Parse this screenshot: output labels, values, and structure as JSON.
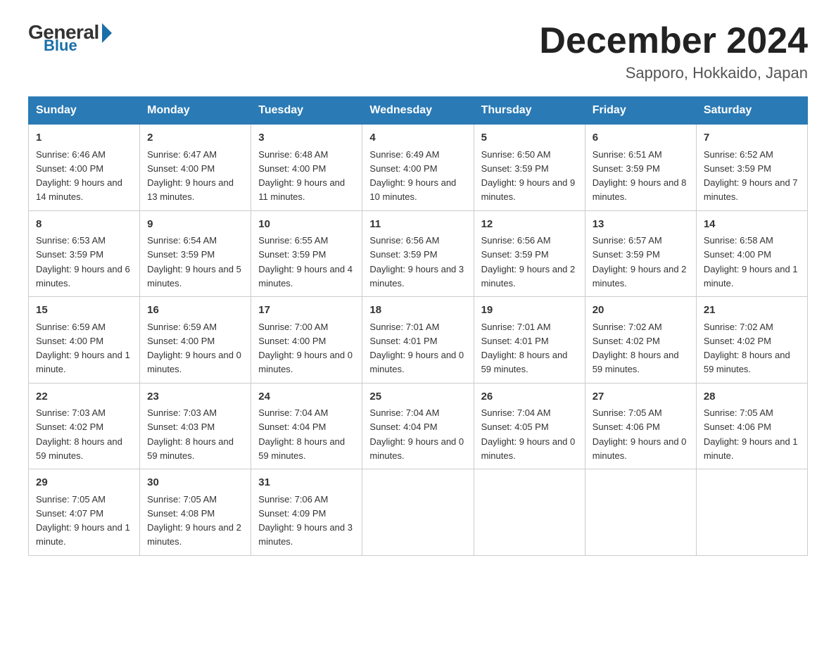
{
  "logo": {
    "general": "General",
    "blue": "Blue"
  },
  "title": "December 2024",
  "location": "Sapporo, Hokkaido, Japan",
  "headers": [
    "Sunday",
    "Monday",
    "Tuesday",
    "Wednesday",
    "Thursday",
    "Friday",
    "Saturday"
  ],
  "weeks": [
    [
      {
        "day": "1",
        "sunrise": "6:46 AM",
        "sunset": "4:00 PM",
        "daylight": "9 hours and 14 minutes."
      },
      {
        "day": "2",
        "sunrise": "6:47 AM",
        "sunset": "4:00 PM",
        "daylight": "9 hours and 13 minutes."
      },
      {
        "day": "3",
        "sunrise": "6:48 AM",
        "sunset": "4:00 PM",
        "daylight": "9 hours and 11 minutes."
      },
      {
        "day": "4",
        "sunrise": "6:49 AM",
        "sunset": "4:00 PM",
        "daylight": "9 hours and 10 minutes."
      },
      {
        "day": "5",
        "sunrise": "6:50 AM",
        "sunset": "3:59 PM",
        "daylight": "9 hours and 9 minutes."
      },
      {
        "day": "6",
        "sunrise": "6:51 AM",
        "sunset": "3:59 PM",
        "daylight": "9 hours and 8 minutes."
      },
      {
        "day": "7",
        "sunrise": "6:52 AM",
        "sunset": "3:59 PM",
        "daylight": "9 hours and 7 minutes."
      }
    ],
    [
      {
        "day": "8",
        "sunrise": "6:53 AM",
        "sunset": "3:59 PM",
        "daylight": "9 hours and 6 minutes."
      },
      {
        "day": "9",
        "sunrise": "6:54 AM",
        "sunset": "3:59 PM",
        "daylight": "9 hours and 5 minutes."
      },
      {
        "day": "10",
        "sunrise": "6:55 AM",
        "sunset": "3:59 PM",
        "daylight": "9 hours and 4 minutes."
      },
      {
        "day": "11",
        "sunrise": "6:56 AM",
        "sunset": "3:59 PM",
        "daylight": "9 hours and 3 minutes."
      },
      {
        "day": "12",
        "sunrise": "6:56 AM",
        "sunset": "3:59 PM",
        "daylight": "9 hours and 2 minutes."
      },
      {
        "day": "13",
        "sunrise": "6:57 AM",
        "sunset": "3:59 PM",
        "daylight": "9 hours and 2 minutes."
      },
      {
        "day": "14",
        "sunrise": "6:58 AM",
        "sunset": "4:00 PM",
        "daylight": "9 hours and 1 minute."
      }
    ],
    [
      {
        "day": "15",
        "sunrise": "6:59 AM",
        "sunset": "4:00 PM",
        "daylight": "9 hours and 1 minute."
      },
      {
        "day": "16",
        "sunrise": "6:59 AM",
        "sunset": "4:00 PM",
        "daylight": "9 hours and 0 minutes."
      },
      {
        "day": "17",
        "sunrise": "7:00 AM",
        "sunset": "4:00 PM",
        "daylight": "9 hours and 0 minutes."
      },
      {
        "day": "18",
        "sunrise": "7:01 AM",
        "sunset": "4:01 PM",
        "daylight": "9 hours and 0 minutes."
      },
      {
        "day": "19",
        "sunrise": "7:01 AM",
        "sunset": "4:01 PM",
        "daylight": "8 hours and 59 minutes."
      },
      {
        "day": "20",
        "sunrise": "7:02 AM",
        "sunset": "4:02 PM",
        "daylight": "8 hours and 59 minutes."
      },
      {
        "day": "21",
        "sunrise": "7:02 AM",
        "sunset": "4:02 PM",
        "daylight": "8 hours and 59 minutes."
      }
    ],
    [
      {
        "day": "22",
        "sunrise": "7:03 AM",
        "sunset": "4:02 PM",
        "daylight": "8 hours and 59 minutes."
      },
      {
        "day": "23",
        "sunrise": "7:03 AM",
        "sunset": "4:03 PM",
        "daylight": "8 hours and 59 minutes."
      },
      {
        "day": "24",
        "sunrise": "7:04 AM",
        "sunset": "4:04 PM",
        "daylight": "8 hours and 59 minutes."
      },
      {
        "day": "25",
        "sunrise": "7:04 AM",
        "sunset": "4:04 PM",
        "daylight": "9 hours and 0 minutes."
      },
      {
        "day": "26",
        "sunrise": "7:04 AM",
        "sunset": "4:05 PM",
        "daylight": "9 hours and 0 minutes."
      },
      {
        "day": "27",
        "sunrise": "7:05 AM",
        "sunset": "4:06 PM",
        "daylight": "9 hours and 0 minutes."
      },
      {
        "day": "28",
        "sunrise": "7:05 AM",
        "sunset": "4:06 PM",
        "daylight": "9 hours and 1 minute."
      }
    ],
    [
      {
        "day": "29",
        "sunrise": "7:05 AM",
        "sunset": "4:07 PM",
        "daylight": "9 hours and 1 minute."
      },
      {
        "day": "30",
        "sunrise": "7:05 AM",
        "sunset": "4:08 PM",
        "daylight": "9 hours and 2 minutes."
      },
      {
        "day": "31",
        "sunrise": "7:06 AM",
        "sunset": "4:09 PM",
        "daylight": "9 hours and 3 minutes."
      },
      null,
      null,
      null,
      null
    ]
  ]
}
